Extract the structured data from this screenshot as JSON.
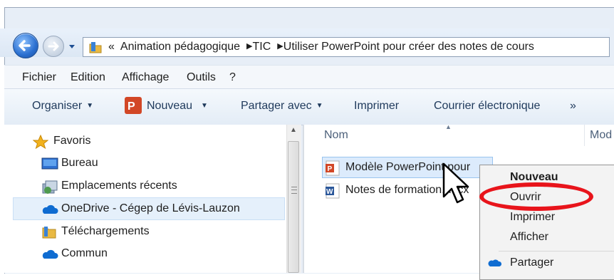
{
  "address": {
    "overflow": "«",
    "crumbs": [
      "Animation pédagogique",
      "TIC",
      "Utiliser PowerPoint pour créer des notes de cours"
    ]
  },
  "menu": [
    "Fichier",
    "Edition",
    "Affichage",
    "Outils",
    "?"
  ],
  "toolbar": {
    "organiser": "Organiser",
    "nouveau": "Nouveau",
    "partager": "Partager avec",
    "imprimer": "Imprimer",
    "courrier": "Courrier électronique",
    "more": "»"
  },
  "nav": {
    "favoris": "Favoris",
    "bureau": "Bureau",
    "recents": "Emplacements récents",
    "onedrive": "OneDrive - Cégep de Lévis-Lauzon",
    "telechargements": "Téléchargements",
    "commun": "Commun"
  },
  "columns": {
    "nom": "Nom",
    "modified": "Mod"
  },
  "files": [
    {
      "name": "Modèle PowerPoint pour"
    },
    {
      "name": "Notes de formation.docx"
    }
  ],
  "context_menu": {
    "nouveau": "Nouveau",
    "ouvrir": "Ouvrir",
    "imprimer": "Imprimer",
    "afficher": "Afficher",
    "partager": "Partager"
  },
  "colors": {
    "accent": "#2a6fd0",
    "highlight_ring": "#e8141b",
    "powerpoint": "#d24726",
    "word": "#2b579a",
    "onedrive": "#0f6cd1"
  }
}
